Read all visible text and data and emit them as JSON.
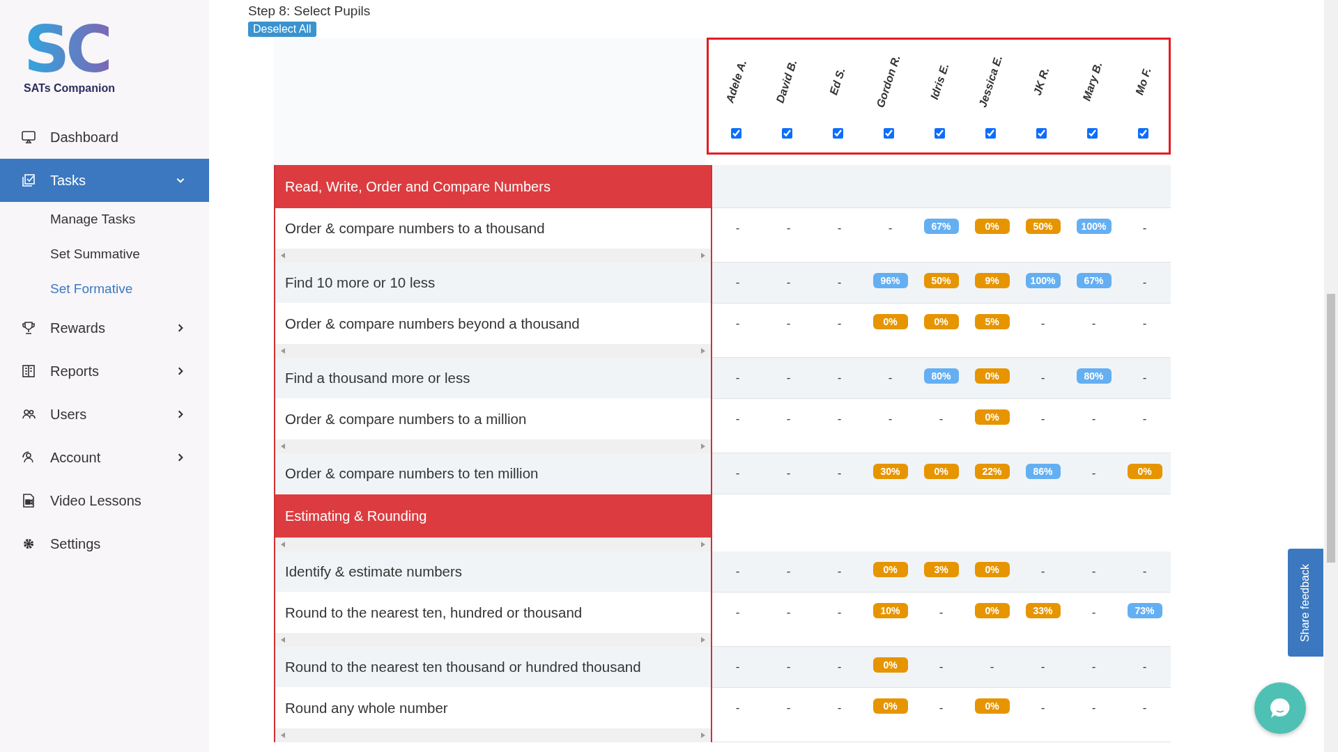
{
  "sidebar": {
    "logo_mark": "SC",
    "logo_text": "SATs Companion",
    "items": [
      {
        "label": "Dashboard",
        "selected": false
      },
      {
        "label": "Tasks",
        "selected": true,
        "expanded": true,
        "children": [
          {
            "label": "Manage Tasks",
            "selected": false
          },
          {
            "label": "Set Summative",
            "selected": false
          },
          {
            "label": "Set Formative",
            "selected": true
          }
        ]
      },
      {
        "label": "Rewards",
        "selected": false,
        "expanded": false
      },
      {
        "label": "Reports",
        "selected": false,
        "expanded": false
      },
      {
        "label": "Users",
        "selected": false,
        "expanded": false
      },
      {
        "label": "Account",
        "selected": false,
        "expanded": false
      },
      {
        "label": "Video Lessons",
        "selected": false
      },
      {
        "label": "Settings",
        "selected": false
      }
    ]
  },
  "step_title": "Step 8: Select Pupils",
  "deselect_button": "Deselect All",
  "pupils": [
    {
      "name": "Adele A.",
      "checked": true
    },
    {
      "name": "David B.",
      "checked": true
    },
    {
      "name": "Ed S.",
      "checked": true
    },
    {
      "name": "Gordon R.",
      "checked": true
    },
    {
      "name": "Idris E.",
      "checked": true
    },
    {
      "name": "Jessica E.",
      "checked": true
    },
    {
      "name": "JK R.",
      "checked": true
    },
    {
      "name": "Mary B.",
      "checked": true
    },
    {
      "name": "Mo F.",
      "checked": true
    }
  ],
  "rows": [
    {
      "kind": "category",
      "label": "Read, Write, Order and Compare Numbers",
      "scrollbar": false
    },
    {
      "kind": "objective",
      "label": "Order & compare numbers to a thousand",
      "scrollbar": true,
      "cells": [
        {
          "text": "-"
        },
        {
          "text": "-"
        },
        {
          "text": "-"
        },
        {
          "text": "-"
        },
        {
          "text": "67%",
          "color": "#64aff2"
        },
        {
          "text": "0%",
          "color": "#e69500"
        },
        {
          "text": "50%",
          "color": "#e69500"
        },
        {
          "text": "100%",
          "color": "#64aff2"
        },
        {
          "text": "-"
        }
      ]
    },
    {
      "kind": "objective",
      "label": "Find 10 more or 10 less",
      "scrollbar": false,
      "cells": [
        {
          "text": "-"
        },
        {
          "text": "-"
        },
        {
          "text": "-"
        },
        {
          "text": "96%",
          "color": "#64aff2"
        },
        {
          "text": "50%",
          "color": "#e69500"
        },
        {
          "text": "9%",
          "color": "#e69500"
        },
        {
          "text": "100%",
          "color": "#64aff2"
        },
        {
          "text": "67%",
          "color": "#64aff2"
        },
        {
          "text": "-"
        }
      ]
    },
    {
      "kind": "objective",
      "label": "Order & compare numbers beyond a thousand",
      "scrollbar": true,
      "cells": [
        {
          "text": "-"
        },
        {
          "text": "-"
        },
        {
          "text": "-"
        },
        {
          "text": "0%",
          "color": "#e69500"
        },
        {
          "text": "0%",
          "color": "#e69500"
        },
        {
          "text": "5%",
          "color": "#e69500"
        },
        {
          "text": "-"
        },
        {
          "text": "-"
        },
        {
          "text": "-"
        }
      ]
    },
    {
      "kind": "objective",
      "label": "Find a thousand more or less",
      "scrollbar": false,
      "cells": [
        {
          "text": "-"
        },
        {
          "text": "-"
        },
        {
          "text": "-"
        },
        {
          "text": "-"
        },
        {
          "text": "80%",
          "color": "#64aff2"
        },
        {
          "text": "0%",
          "color": "#e69500"
        },
        {
          "text": "-"
        },
        {
          "text": "80%",
          "color": "#64aff2"
        },
        {
          "text": "-"
        }
      ]
    },
    {
      "kind": "objective",
      "label": "Order & compare numbers to a million",
      "scrollbar": true,
      "cells": [
        {
          "text": "-"
        },
        {
          "text": "-"
        },
        {
          "text": "-"
        },
        {
          "text": "-"
        },
        {
          "text": "-"
        },
        {
          "text": "0%",
          "color": "#e69500"
        },
        {
          "text": "-"
        },
        {
          "text": "-"
        },
        {
          "text": "-"
        }
      ]
    },
    {
      "kind": "objective",
      "label": "Order & compare numbers to ten million",
      "scrollbar": false,
      "cells": [
        {
          "text": "-"
        },
        {
          "text": "-"
        },
        {
          "text": "-"
        },
        {
          "text": "30%",
          "color": "#e69500"
        },
        {
          "text": "0%",
          "color": "#e69500"
        },
        {
          "text": "22%",
          "color": "#e69500"
        },
        {
          "text": "86%",
          "color": "#64aff2"
        },
        {
          "text": "-"
        },
        {
          "text": "0%",
          "color": "#e69500"
        }
      ]
    },
    {
      "kind": "category",
      "label": "Estimating & Rounding",
      "scrollbar": true
    },
    {
      "kind": "objective",
      "label": "Identify & estimate numbers",
      "scrollbar": false,
      "cells": [
        {
          "text": "-"
        },
        {
          "text": "-"
        },
        {
          "text": "-"
        },
        {
          "text": "0%",
          "color": "#e69500"
        },
        {
          "text": "3%",
          "color": "#e69500"
        },
        {
          "text": "0%",
          "color": "#e69500"
        },
        {
          "text": "-"
        },
        {
          "text": "-"
        },
        {
          "text": "-"
        }
      ]
    },
    {
      "kind": "objective",
      "label": "Round to the nearest ten, hundred or thousand",
      "scrollbar": true,
      "cells": [
        {
          "text": "-"
        },
        {
          "text": "-"
        },
        {
          "text": "-"
        },
        {
          "text": "10%",
          "color": "#e69500"
        },
        {
          "text": "-"
        },
        {
          "text": "0%",
          "color": "#e69500"
        },
        {
          "text": "33%",
          "color": "#e69500"
        },
        {
          "text": "-"
        },
        {
          "text": "73%",
          "color": "#64aff2"
        }
      ]
    },
    {
      "kind": "objective",
      "label": "Round to the nearest ten thousand or hundred thousand",
      "scrollbar": false,
      "cells": [
        {
          "text": "-"
        },
        {
          "text": "-"
        },
        {
          "text": "-"
        },
        {
          "text": "0%",
          "color": "#e69500"
        },
        {
          "text": "-"
        },
        {
          "text": "-"
        },
        {
          "text": "-"
        },
        {
          "text": "-"
        },
        {
          "text": "-"
        }
      ]
    },
    {
      "kind": "objective",
      "label": "Round any whole number",
      "scrollbar": true,
      "cells": [
        {
          "text": "-"
        },
        {
          "text": "-"
        },
        {
          "text": "-"
        },
        {
          "text": "0%",
          "color": "#e69500"
        },
        {
          "text": "-"
        },
        {
          "text": "0%",
          "color": "#e69500"
        },
        {
          "text": "-"
        },
        {
          "text": "-"
        },
        {
          "text": "-"
        }
      ]
    }
  ],
  "feedback_button": "Share feedback"
}
